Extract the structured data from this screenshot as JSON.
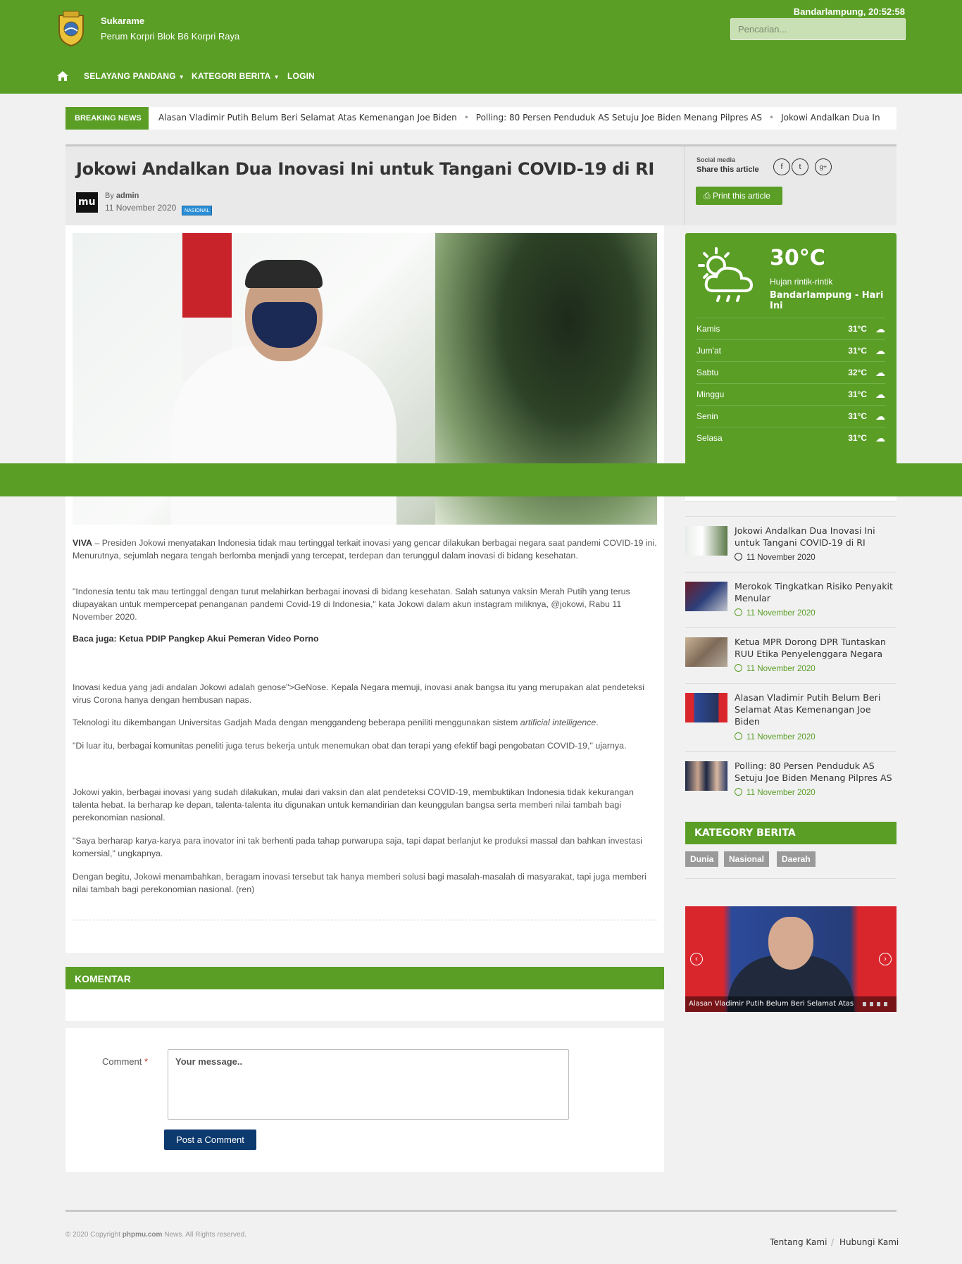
{
  "header": {
    "site_name": "Sukarame",
    "address": "Perum Korpri Blok B6 Korpri Raya",
    "clock": "Bandarlampung, 20:52:58",
    "search_placeholder": "Pencarian..."
  },
  "nav": {
    "items": [
      {
        "label": "SELAYANG PANDANG",
        "has_caret": true
      },
      {
        "label": "KATEGORI BERITA",
        "has_caret": true
      },
      {
        "label": "LOGIN",
        "has_caret": false
      }
    ]
  },
  "breaking": {
    "label": "BREAKING NEWS",
    "items": [
      "Alasan Vladimir Putih Belum Beri Selamat Atas Kemenangan Joe Biden",
      "Polling: 80 Persen Penduduk AS Setuju Joe Biden Menang Pilpres AS",
      "Jokowi Andalkan Dua Inovasi"
    ]
  },
  "article": {
    "title": "Jokowi Andalkan Dua Inovasi Ini untuk Tangani COVID-19 di RI",
    "avatar_text": "mu",
    "by": "By",
    "author": "admin",
    "date": "11 November 2020",
    "category": "NASIONAL",
    "share_small": "Social media",
    "share_label": "Share this article",
    "share_icons": [
      "f",
      "t",
      "g+"
    ],
    "print_label": "Print this article",
    "paragraphs": {
      "p1_lead": "VIVA",
      "p1": " – Presiden Jokowi menyatakan Indonesia tidak mau tertinggal terkait inovasi yang gencar dilakukan berbagai negara saat pandemi COVID-19 ini. Menurutnya, sejumlah negara tengah berlomba menjadi yang tercepat, terdepan dan terunggul dalam inovasi di bidang kesehatan.",
      "p2": "\"Indonesia tentu tak mau tertinggal dengan turut melahirkan berbagai inovasi di bidang kesehatan. Salah satunya vaksin Merah Putih yang terus diupayakan untuk mempercepat penanganan pandemi Covid-19 di Indonesia,\" kata Jokowi dalam akun instagram miliknya, @jokowi, Rabu 11 November 2020.",
      "p3": "Baca juga: Ketua PDIP Pangkep Akui Pemeran Video Porno",
      "p4": "Inovasi kedua yang jadi andalan Jokowi adalah genose\">GeNose. Kepala Negara memuji, inovasi anak bangsa itu yang merupakan alat pendeteksi virus Corona hanya dengan hembusan napas.",
      "p5a": "Teknologi itu dikembangan Universitas Gadjah Mada dengan menggandeng beberapa peniliti menggunakan sistem ",
      "p5b": "artificial intelligence",
      "p5c": ".",
      "p6": "\"Di luar itu, berbagai komunitas peneliti juga terus bekerja untuk menemukan obat dan terapi yang efektif bagi pengobatan COVID-19,\" ujarnya.",
      "p7": "Jokowi yakin, berbagai inovasi yang sudah dilakukan, mulai dari vaksin dan alat pendeteksi COVID-19, membuktikan Indonesia tidak kekurangan talenta hebat. Ia berharap ke depan, talenta-talenta itu digunakan untuk kemandirian dan keunggulan bangsa serta memberi nilai tambah bagi perekonomian nasional.",
      "p8": "\"Saya berharap karya-karya para inovator ini tak berhenti pada tahap purwarupa saja, tapi dapat berlanjut ke produksi massal dan bahkan investasi komersial,\" ungkapnya.",
      "p9": "Dengan begitu, Jokowi menambahkan, beragam inovasi tersebut tak hanya memberi solusi bagi masalah-masalah di masyarakat, tapi juga memberi nilai tambah bagi perekonomian nasional. (ren)"
    }
  },
  "comments": {
    "heading": "KOMENTAR",
    "label": "Comment",
    "required_mark": "*",
    "placeholder": "Your message..",
    "submit": "Post a Comment"
  },
  "weather": {
    "temp": "30°C",
    "desc": "Hujan rintik-rintik",
    "location": "Bandarlampung - Hari Ini",
    "forecast": [
      {
        "day": "Kamis",
        "temp": "31°C"
      },
      {
        "day": "Jum'at",
        "temp": "31°C"
      },
      {
        "day": "Sabtu",
        "temp": "32°C"
      },
      {
        "day": "Minggu",
        "temp": "31°C"
      },
      {
        "day": "Senin",
        "temp": "31°C"
      },
      {
        "day": "Selasa",
        "temp": "31°C"
      }
    ]
  },
  "related": [
    {
      "title": "Jokowi Andalkan Dua Inovasi Ini untuk Tangani COVID-19 di RI",
      "date": "11 November 2020",
      "active": true
    },
    {
      "title": "Merokok Tingkatkan Risiko Penyakit Menular",
      "date": "11 November 2020",
      "active": false
    },
    {
      "title": "Ketua MPR Dorong DPR Tuntaskan RUU Etika Penyelenggara Negara",
      "date": "11 November 2020",
      "active": false
    },
    {
      "title": "Alasan Vladimir Putih Belum Beri Selamat Atas Kemenangan Joe Biden",
      "date": "11 November 2020",
      "active": false
    },
    {
      "title": "Polling: 80 Persen Penduduk AS Setuju Joe Biden Menang Pilpres AS",
      "date": "11 November 2020",
      "active": false
    }
  ],
  "categories": {
    "heading": "KATEGORY BERITA",
    "tags": [
      "Dunia",
      "Nasional",
      "Daerah"
    ]
  },
  "slider": {
    "caption": "Alasan Vladimir Putih Belum Beri Selamat Atas"
  },
  "footer": {
    "copy_prefix": "© 2020 Copyright ",
    "copy_brand": "phpmu.com",
    "copy_suffix": " News. All Rights reserved.",
    "links": [
      "Tentang Kami",
      "Hubungi Kami"
    ],
    "link_sep": "/"
  },
  "colors": {
    "brand_green": "#5a9e26",
    "button_navy": "#0c3a6e",
    "badge_blue": "#2b8ed6"
  }
}
